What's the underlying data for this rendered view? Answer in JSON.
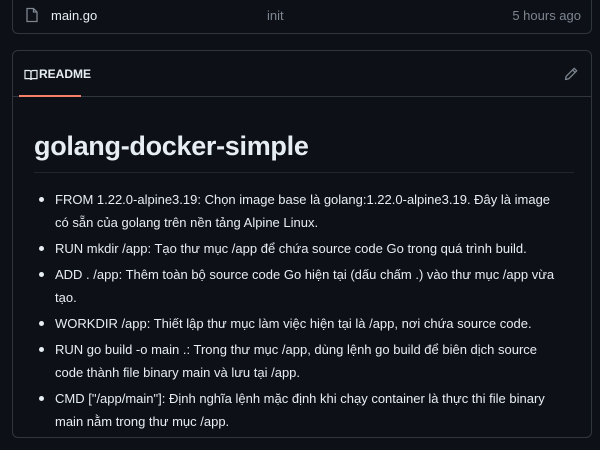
{
  "file_row": {
    "icon": "file-icon",
    "name": "main.go",
    "commit_message": "init",
    "time": "5 hours ago"
  },
  "readme": {
    "tab_label": "README",
    "tab_icon": "book-icon",
    "edit_icon": "pencil-icon",
    "title": "golang-docker-simple",
    "items": [
      "FROM 1.22.0-alpine3.19: Chọn image base là golang:1.22.0-alpine3.19. Đây là image có sẵn của golang trên nền tảng Alpine Linux.",
      "RUN mkdir /app: Tạo thư mục /app để chứa source code Go trong quá trình build.",
      "ADD . /app: Thêm toàn bộ source code Go hiện tại (dấu chấm .) vào thư mục /app vừa tạo.",
      "WORKDIR /app: Thiết lập thư mục làm việc hiện tại là /app, nơi chứa source code.",
      "RUN go build -o main .: Trong thư mục /app, dùng lệnh go build để biên dịch source code thành file binary main và lưu tại /app.",
      "CMD [\"/app/main\"]: Định nghĩa lệnh mặc định khi chạy container là thực thi file binary main nằm trong thư mục /app."
    ]
  },
  "colors": {
    "background": "#0d1117",
    "border": "#30363d",
    "text": "#e6edf3",
    "muted": "#7d8590",
    "tab_underline": "#f78166"
  }
}
